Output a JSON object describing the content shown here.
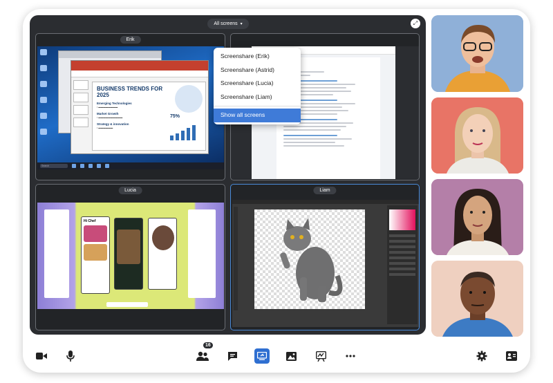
{
  "stage": {
    "selector_label": "All screens",
    "selector_caret": "▾",
    "expand_icon": "⤢"
  },
  "tiles": {
    "erik": "Erik",
    "lucia": "Lucia",
    "liam": "Liam"
  },
  "erik_screen": {
    "slide_title": "BUSINESS TRENDS FOR 2025",
    "heading1": "Emerging Technologies",
    "heading2": "Market Growth",
    "heading3": "Strategy & innovation",
    "stat": "75%",
    "taskbar_search": "Search"
  },
  "dropdown": {
    "items": [
      "Screenshare (Erik)",
      "Screenshare (Astrid)",
      "Screenshare (Lucia)",
      "Screenshare (Liam)"
    ],
    "selected": "Show all screens"
  },
  "lucia_screen": {
    "app_title": "Hi Chef"
  },
  "toolbar": {
    "participants_count": "16"
  },
  "colors": {
    "stage_bg": "#2b2d31",
    "active_border": "#4a8bd9",
    "accent": "#2f6fd1"
  }
}
